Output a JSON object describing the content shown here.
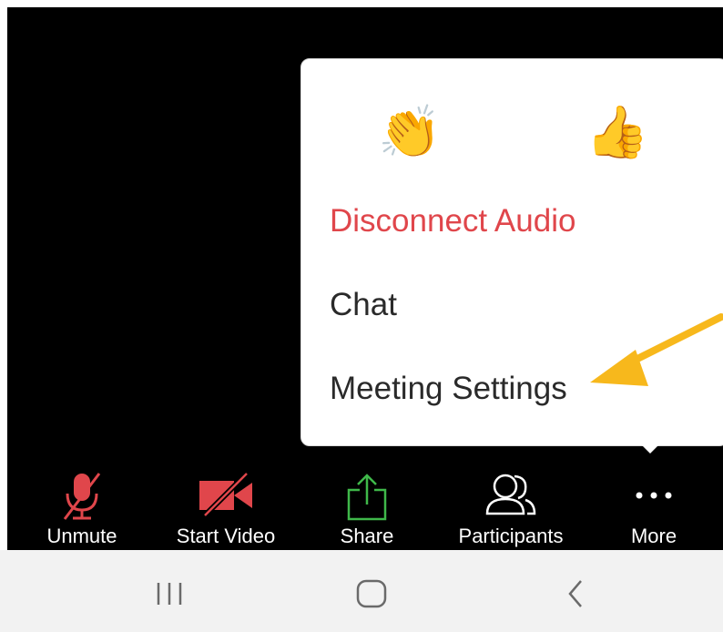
{
  "reactions": {
    "clap": "👏",
    "thumbs_up": "👍"
  },
  "menu": {
    "items": [
      {
        "label": "Disconnect Audio",
        "color": "#e0464b"
      },
      {
        "label": "Chat"
      },
      {
        "label": "Meeting Settings"
      }
    ]
  },
  "toolbar": {
    "buttons": [
      {
        "label": "Unmute",
        "icon": "microphone-muted-icon",
        "color": "#e0464b"
      },
      {
        "label": "Start Video",
        "icon": "video-off-icon",
        "color": "#e0464b"
      },
      {
        "label": "Share",
        "icon": "share-upload-icon",
        "color": "#3fb84a"
      },
      {
        "label": "Participants",
        "icon": "participants-icon"
      },
      {
        "label": "More",
        "icon": "more-dots-icon"
      }
    ]
  },
  "navigation": {
    "recents": "recents-icon",
    "home": "home-icon",
    "back": "back-icon"
  },
  "colors": {
    "annotation_arrow": "#f7b81c",
    "danger": "#e0464b",
    "share_green": "#3fb84a"
  }
}
